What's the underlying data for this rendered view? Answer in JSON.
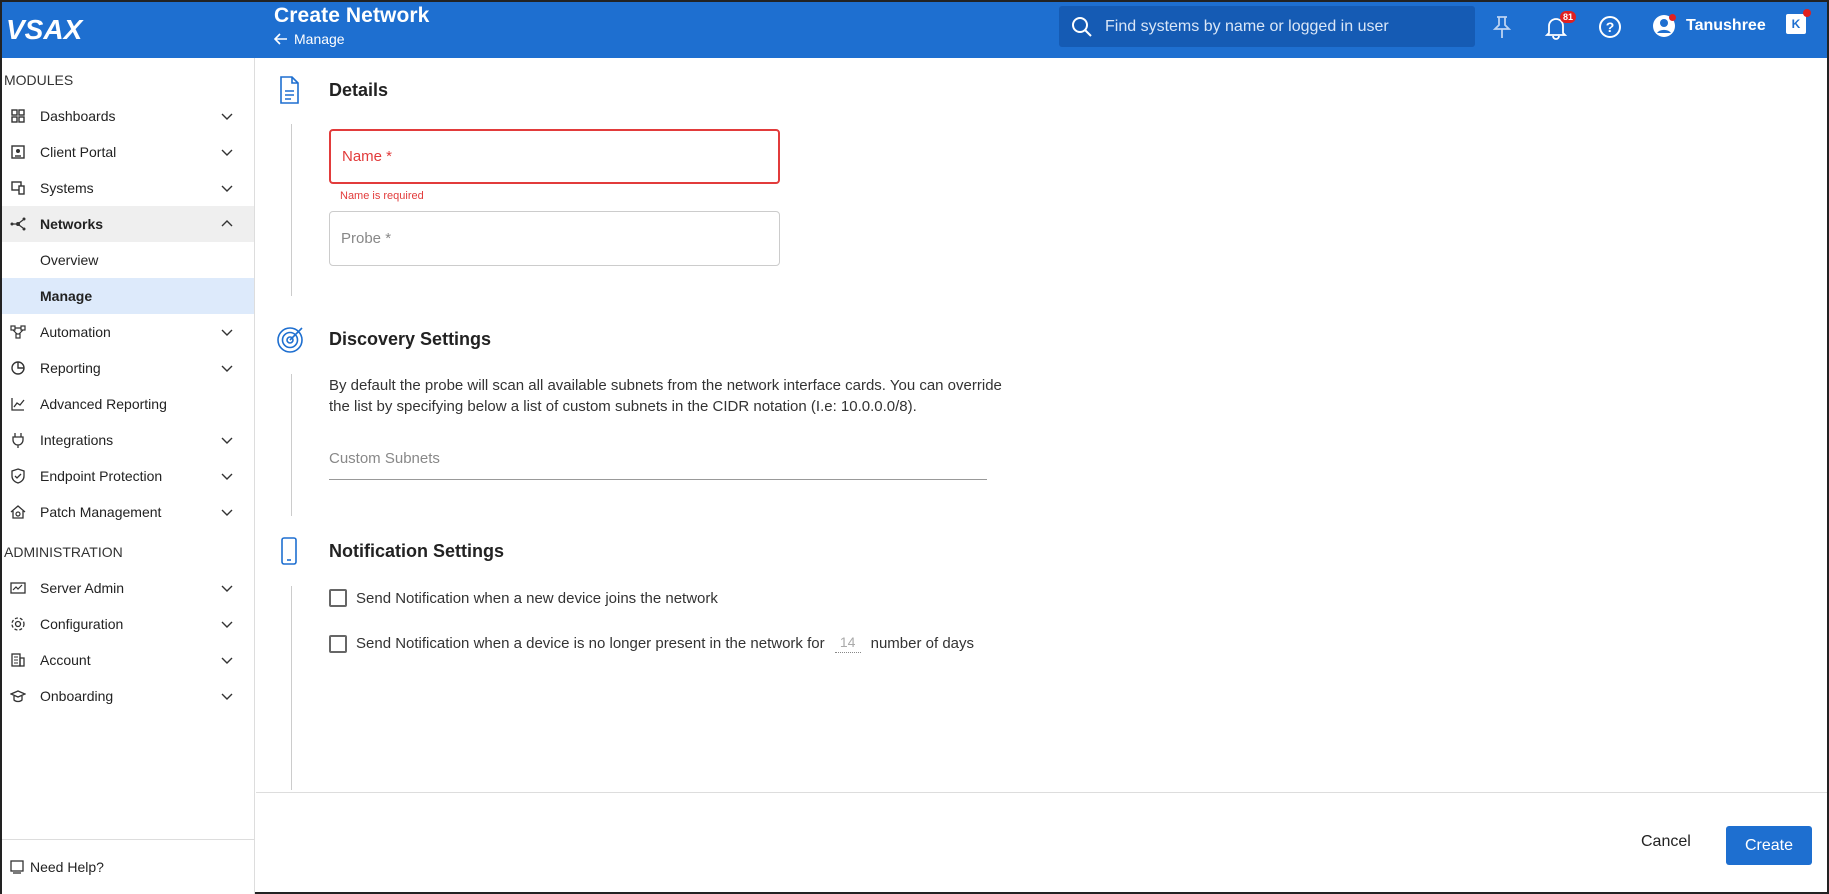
{
  "header": {
    "logo": "VSAX",
    "title": "Create Network",
    "back_label": "Manage",
    "search_placeholder": "Find systems by name or logged in user",
    "notifications_count": "81",
    "user_name": "Tanushree"
  },
  "sidebar": {
    "modules_label": "MODULES",
    "admin_label": "ADMINISTRATION",
    "modules": [
      {
        "label": "Dashboards",
        "icon": "grid-icon"
      },
      {
        "label": "Client Portal",
        "icon": "portal-icon"
      },
      {
        "label": "Systems",
        "icon": "devices-icon"
      },
      {
        "label": "Networks",
        "icon": "network-icon"
      },
      {
        "label": "Overview"
      },
      {
        "label": "Manage"
      },
      {
        "label": "Automation",
        "icon": "automation-icon"
      },
      {
        "label": "Reporting",
        "icon": "pie-chart-icon"
      },
      {
        "label": "Advanced Reporting",
        "icon": "line-chart-icon"
      },
      {
        "label": "Integrations",
        "icon": "plug-icon"
      },
      {
        "label": "Endpoint Protection",
        "icon": "shield-icon"
      },
      {
        "label": "Patch Management",
        "icon": "home-gear-icon"
      }
    ],
    "admin": [
      {
        "label": "Server Admin",
        "icon": "server-icon"
      },
      {
        "label": "Configuration",
        "icon": "gear-icon"
      },
      {
        "label": "Account",
        "icon": "building-icon"
      },
      {
        "label": "Onboarding",
        "icon": "graduation-cap-icon"
      }
    ],
    "help_label": "Need Help?"
  },
  "details": {
    "title": "Details",
    "name_label": "Name *",
    "name_error": "Name is required",
    "probe_label": "Probe *"
  },
  "discovery": {
    "title": "Discovery Settings",
    "description": "By default the probe will scan all available subnets from the network interface cards. You can override the list by specifying below a list of custom subnets in the CIDR notation (I.e: 10.0.0.0/8).",
    "subnets_placeholder": "Custom Subnets"
  },
  "notification": {
    "title": "Notification Settings",
    "option1": "Send Notification when a new device joins the network",
    "option2_prefix": "Send Notification when a device is no longer present in the network for",
    "option2_days": "14",
    "option2_suffix": "number of days"
  },
  "footer": {
    "cancel_label": "Cancel",
    "create_label": "Create"
  },
  "colors": {
    "primary": "#1e6fd0",
    "error": "#e23b3b",
    "selected_bg": "#ddeafb"
  }
}
